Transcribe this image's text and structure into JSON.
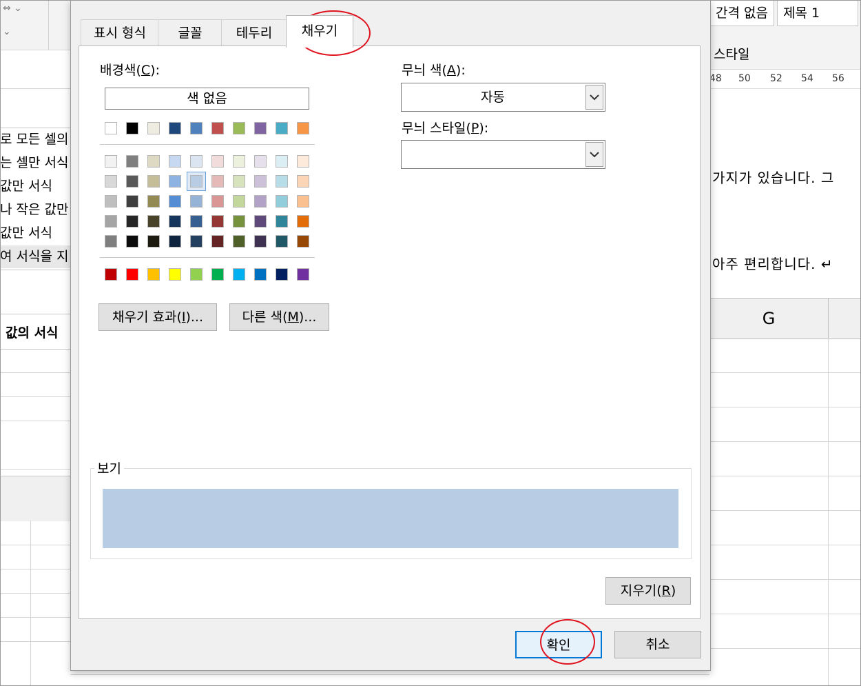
{
  "background": {
    "left_menu": [
      "로 모든 셀의",
      "는 셀만 서식",
      "값만 서식",
      "나 작은 값만",
      "값만 서식",
      "여 서식을 지"
    ],
    "left_header": "값의 서식",
    "styles": [
      "간격 없음",
      "제목 1"
    ],
    "styles_label": "스타일",
    "ruler": [
      "48",
      "50",
      "52",
      "54",
      "56"
    ],
    "doc_line1": "가지가 있습니다. 그",
    "doc_line2": "아주 편리합니다. ↵",
    "column_header": "G"
  },
  "dialog": {
    "tabs": [
      "표시 형식",
      "글꼴",
      "테두리",
      "채우기"
    ],
    "active_tab": "채우기",
    "background_color": {
      "label": "배경색",
      "accel": "C",
      "suffix": "):",
      "no_color": "색 없음"
    },
    "pattern_color": {
      "label": "무늬 색",
      "accel": "A",
      "suffix": "):",
      "value": "자동"
    },
    "pattern_style": {
      "label": "무늬 스타일",
      "accel": "P",
      "suffix": "):",
      "value": ""
    },
    "fill_effects": {
      "label": "채우기 효과",
      "accel": "I",
      "suffix": ")..."
    },
    "more_colors": {
      "label": "다른 색",
      "accel": "M",
      "suffix": ")..."
    },
    "preview_label": "보기",
    "preview_color": "#b8cce4",
    "clear": {
      "label": "지우기",
      "accel": "R",
      "suffix": ")"
    },
    "ok": "확인",
    "cancel": "취소",
    "palette": {
      "theme_top": [
        "#ffffff",
        "#000000",
        "#eeece1",
        "#1f497d",
        "#4f81bd",
        "#c0504d",
        "#9bbb59",
        "#8064a2",
        "#4bacc6",
        "#f79646"
      ],
      "theme_shades": [
        [
          "#f2f2f2",
          "#7f7f7f",
          "#ddd9c3",
          "#c6d9f0",
          "#dbe5f1",
          "#f2dcdb",
          "#ebf1dd",
          "#e5e0ec",
          "#dbeef3",
          "#fdeada"
        ],
        [
          "#d8d8d8",
          "#595959",
          "#c4bd97",
          "#8db3e2",
          "#b8cce4",
          "#e5b9b7",
          "#d7e3bc",
          "#ccc1d9",
          "#b7dde8",
          "#fbd5b5"
        ],
        [
          "#bfbfbf",
          "#3f3f3f",
          "#938953",
          "#548dd4",
          "#95b3d7",
          "#d99694",
          "#c3d69b",
          "#b2a2c7",
          "#92cddc",
          "#fac08f"
        ],
        [
          "#a5a5a5",
          "#262626",
          "#494429",
          "#17365d",
          "#366092",
          "#953734",
          "#76923c",
          "#5f497a",
          "#31859b",
          "#e36c09"
        ],
        [
          "#7f7f7f",
          "#0c0c0c",
          "#1d1b10",
          "#0f243e",
          "#244061",
          "#632423",
          "#4f6128",
          "#3f3151",
          "#205867",
          "#974806"
        ]
      ],
      "standard": [
        "#c00000",
        "#ff0000",
        "#ffc000",
        "#ffff00",
        "#92d050",
        "#00b050",
        "#00b0f0",
        "#0070c0",
        "#002060",
        "#7030a0"
      ],
      "selected_color": "#b8cce4"
    }
  },
  "annotation_color": "#e0141e"
}
